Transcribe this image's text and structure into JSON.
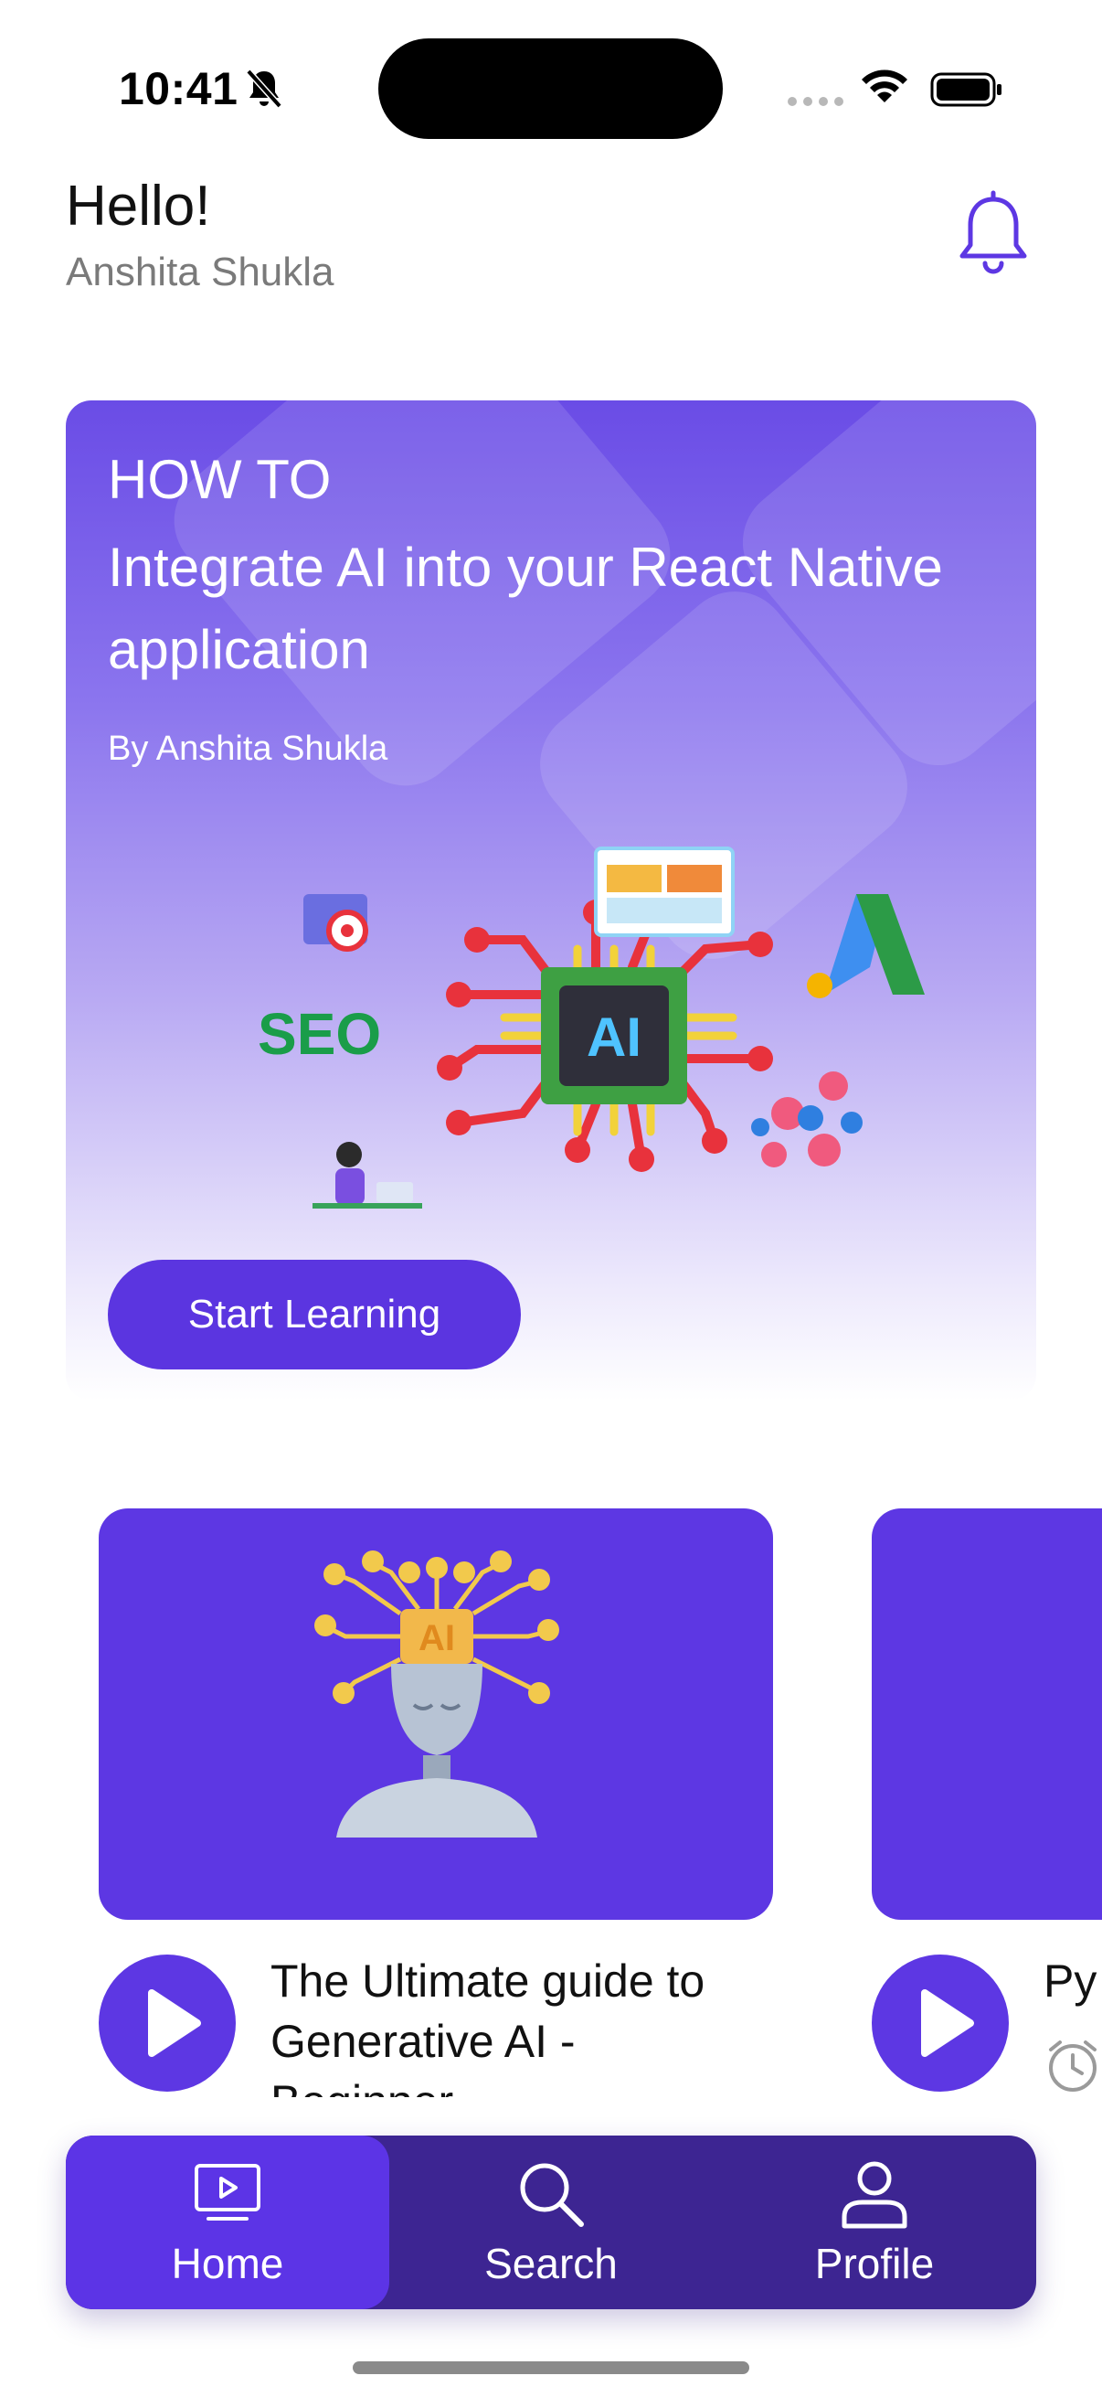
{
  "status_bar": {
    "time": "10:41",
    "icons": [
      "bell-slash-icon",
      "signal-icon",
      "wifi-icon",
      "battery-icon"
    ]
  },
  "greeting": {
    "title": "Hello!",
    "name": "Anshita Shukla",
    "notification_icon": "bell-icon"
  },
  "hero": {
    "eyebrow": "HOW TO",
    "title": "Integrate AI into your React Native application",
    "author": "By Anshita Shukla",
    "button_label": "Start Learning",
    "illustration_text": {
      "chip": "AI",
      "seo": "SEO"
    }
  },
  "courses": [
    {
      "title": "The Ultimate guide to Generative AI - Beginner",
      "thumb_text": "AI",
      "icon": "play-icon"
    },
    {
      "title": "Py",
      "icon": "play-icon",
      "meta_icon": "clock-icon"
    }
  ],
  "tab_bar": {
    "tabs": [
      {
        "label": "Home",
        "icon": "tv-play-icon",
        "active": true
      },
      {
        "label": "Search",
        "icon": "search-icon",
        "active": false
      },
      {
        "label": "Profile",
        "icon": "user-icon",
        "active": false
      }
    ]
  },
  "colors": {
    "accent": "#5d37e3",
    "tab_bar": "#3d2592",
    "tab_active": "#5c34e6"
  }
}
